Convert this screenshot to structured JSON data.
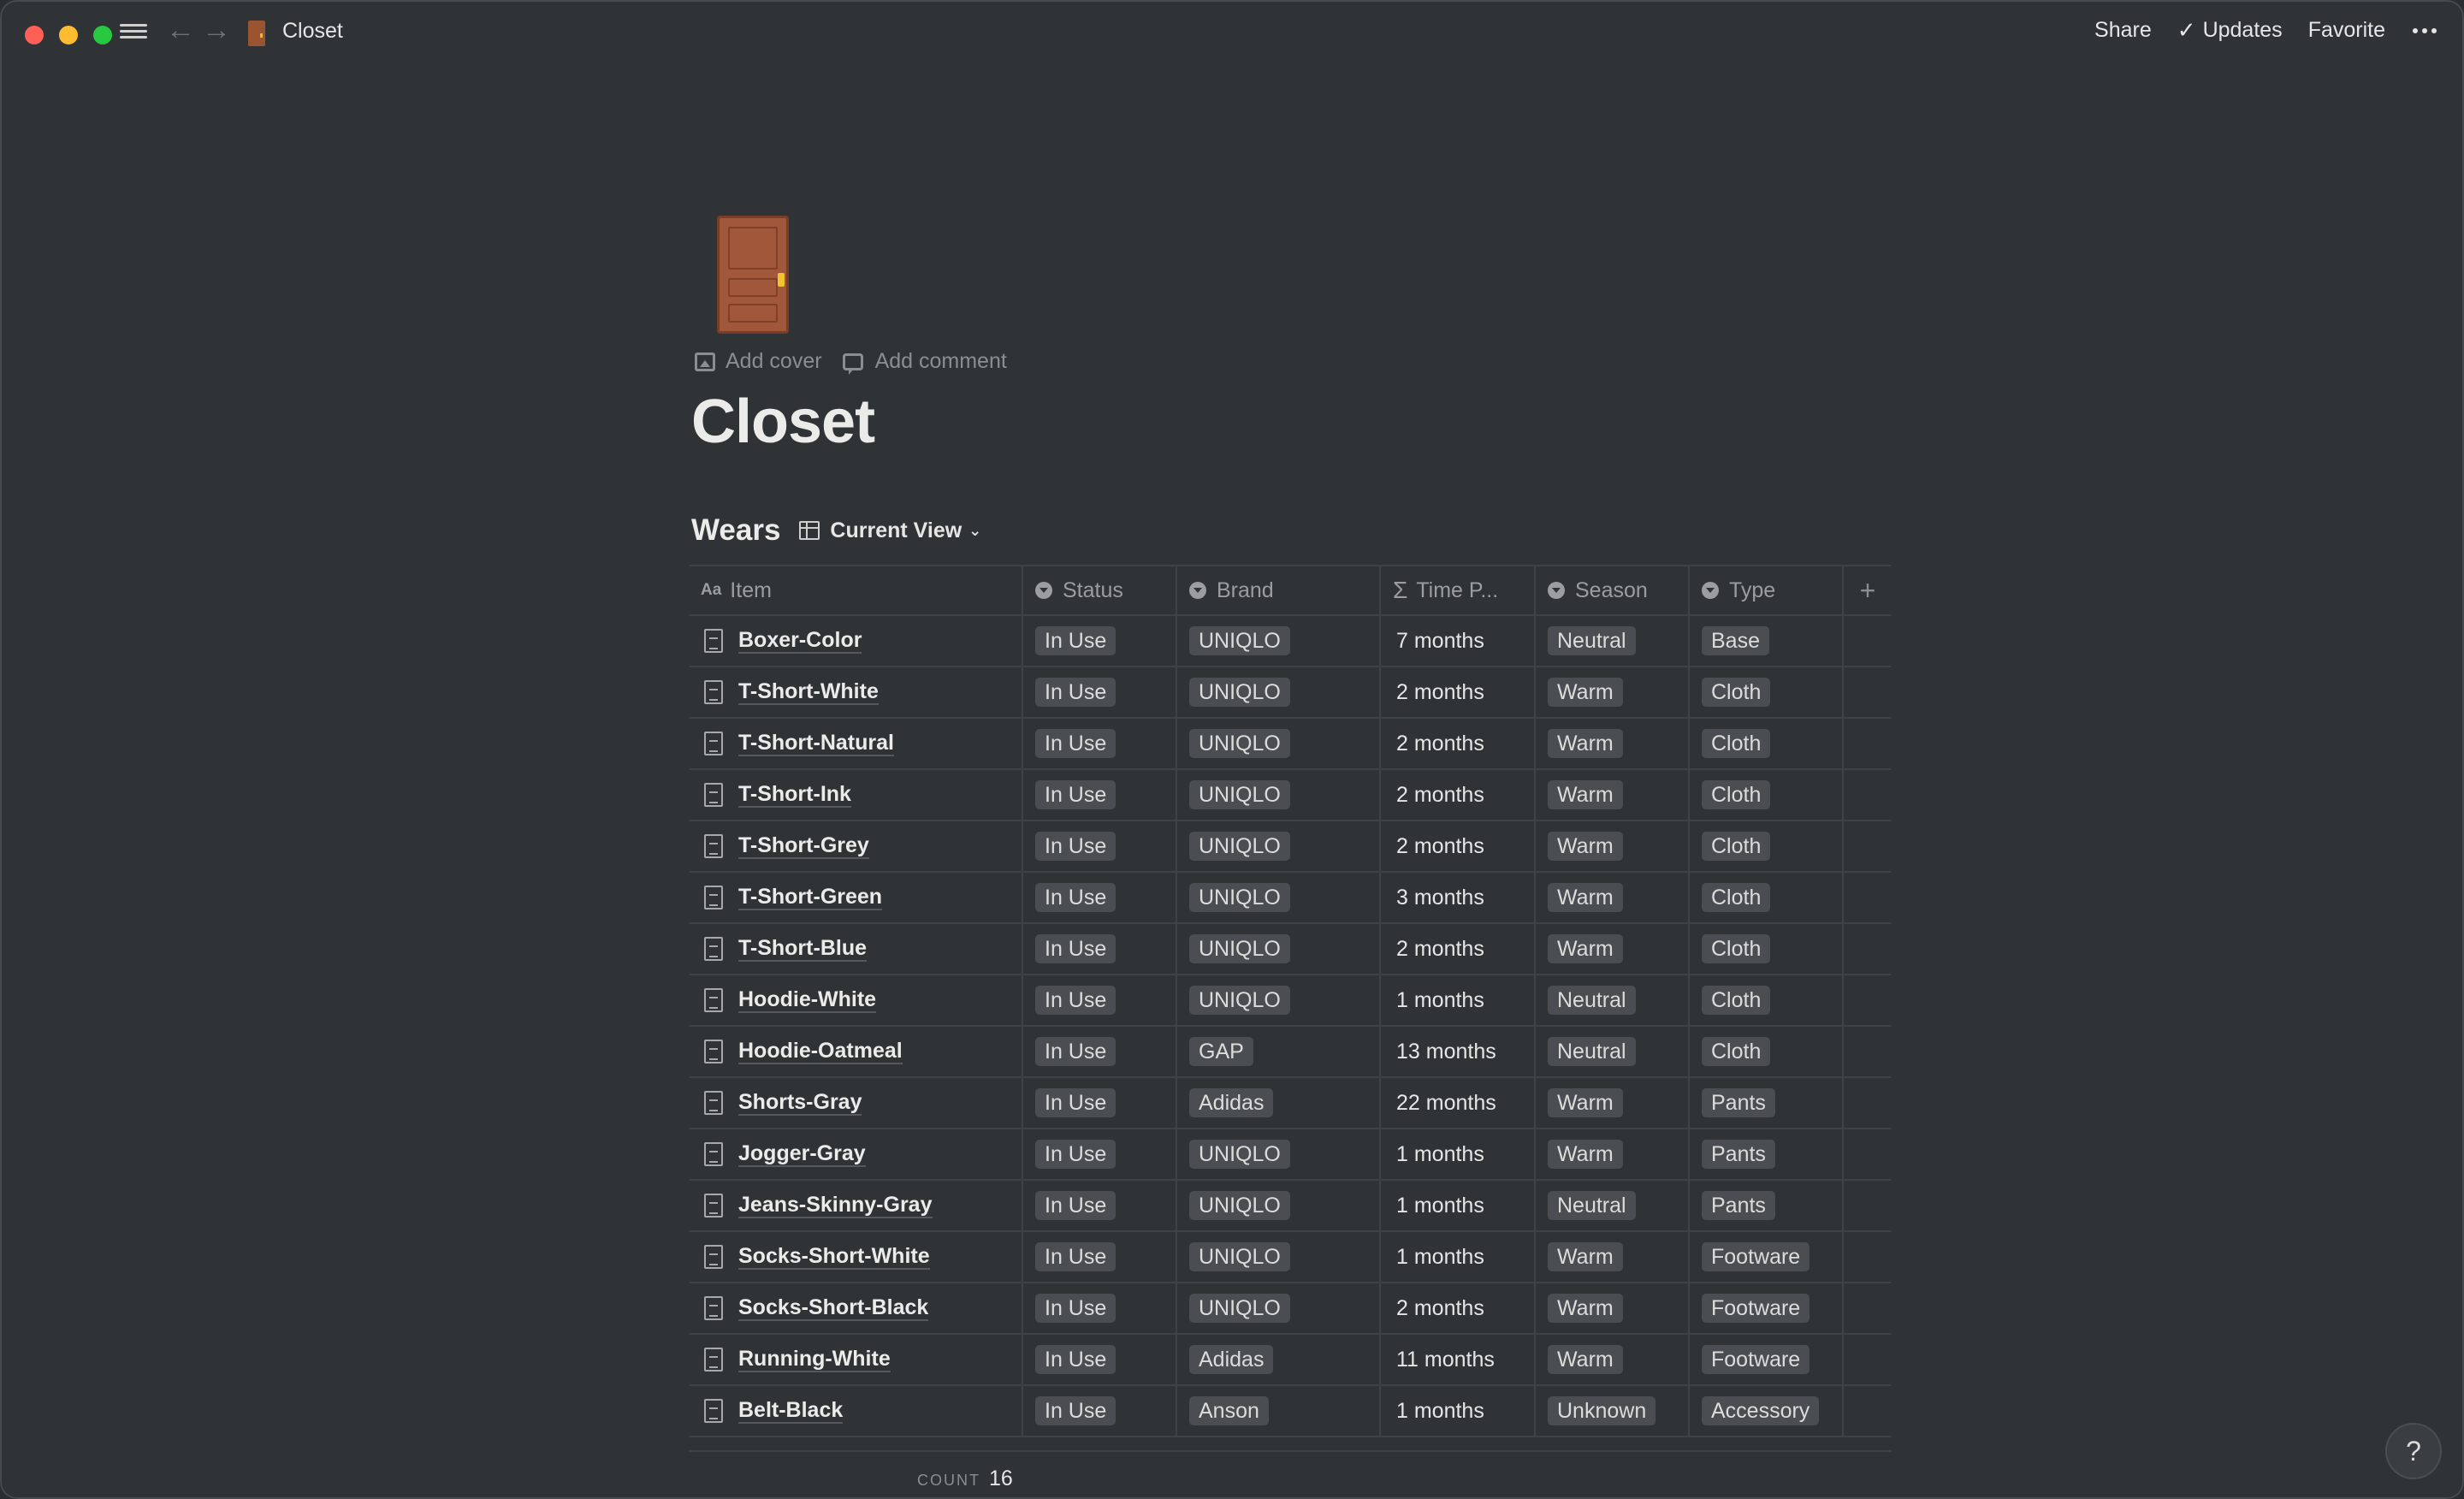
{
  "window": {
    "breadcrumb_title": "Closet",
    "actions": {
      "share": "Share",
      "updates": "Updates",
      "favorite": "Favorite"
    }
  },
  "page": {
    "icon": "door-icon",
    "add_cover": "Add cover",
    "add_comment": "Add comment",
    "title": "Closet"
  },
  "database": {
    "title": "Wears",
    "view_label": "Current View",
    "columns": [
      {
        "label": "Item",
        "icon": "text-icon"
      },
      {
        "label": "Status",
        "icon": "select-icon"
      },
      {
        "label": "Brand",
        "icon": "select-icon"
      },
      {
        "label": "Time P...",
        "icon": "sigma-icon"
      },
      {
        "label": "Season",
        "icon": "select-icon"
      },
      {
        "label": "Type",
        "icon": "select-icon"
      }
    ],
    "add_column": "+",
    "rows": [
      {
        "item": "Boxer-Color",
        "status": "In Use",
        "brand": "UNIQLO",
        "time": "7 months",
        "season": "Neutral",
        "type": "Base"
      },
      {
        "item": "T-Short-White",
        "status": "In Use",
        "brand": "UNIQLO",
        "time": "2 months",
        "season": "Warm",
        "type": "Cloth"
      },
      {
        "item": "T-Short-Natural",
        "status": "In Use",
        "brand": "UNIQLO",
        "time": "2 months",
        "season": "Warm",
        "type": "Cloth"
      },
      {
        "item": "T-Short-Ink",
        "status": "In Use",
        "brand": "UNIQLO",
        "time": "2 months",
        "season": "Warm",
        "type": "Cloth"
      },
      {
        "item": "T-Short-Grey",
        "status": "In Use",
        "brand": "UNIQLO",
        "time": "2 months",
        "season": "Warm",
        "type": "Cloth"
      },
      {
        "item": "T-Short-Green",
        "status": "In Use",
        "brand": "UNIQLO",
        "time": "3 months",
        "season": "Warm",
        "type": "Cloth"
      },
      {
        "item": "T-Short-Blue",
        "status": "In Use",
        "brand": "UNIQLO",
        "time": "2 months",
        "season": "Warm",
        "type": "Cloth"
      },
      {
        "item": "Hoodie-White",
        "status": "In Use",
        "brand": "UNIQLO",
        "time": "1 months",
        "season": "Neutral",
        "type": "Cloth"
      },
      {
        "item": "Hoodie-Oatmeal",
        "status": "In Use",
        "brand": "GAP",
        "time": "13 months",
        "season": "Neutral",
        "type": "Cloth"
      },
      {
        "item": "Shorts-Gray",
        "status": "In Use",
        "brand": "Adidas",
        "time": "22 months",
        "season": "Warm",
        "type": "Pants"
      },
      {
        "item": "Jogger-Gray",
        "status": "In Use",
        "brand": "UNIQLO",
        "time": "1 months",
        "season": "Warm",
        "type": "Pants"
      },
      {
        "item": "Jeans-Skinny-Gray",
        "status": "In Use",
        "brand": "UNIQLO",
        "time": "1 months",
        "season": "Neutral",
        "type": "Pants"
      },
      {
        "item": "Socks-Short-White",
        "status": "In Use",
        "brand": "UNIQLO",
        "time": "1 months",
        "season": "Warm",
        "type": "Footware"
      },
      {
        "item": "Socks-Short-Black",
        "status": "In Use",
        "brand": "UNIQLO",
        "time": "2 months",
        "season": "Warm",
        "type": "Footware"
      },
      {
        "item": "Running-White",
        "status": "In Use",
        "brand": "Adidas",
        "time": "11 months",
        "season": "Warm",
        "type": "Footware"
      },
      {
        "item": "Belt-Black",
        "status": "In Use",
        "brand": "Anson",
        "time": "1 months",
        "season": "Unknown",
        "type": "Accessory"
      }
    ],
    "count_label": "COUNT",
    "count_value": "16"
  },
  "help": "?"
}
